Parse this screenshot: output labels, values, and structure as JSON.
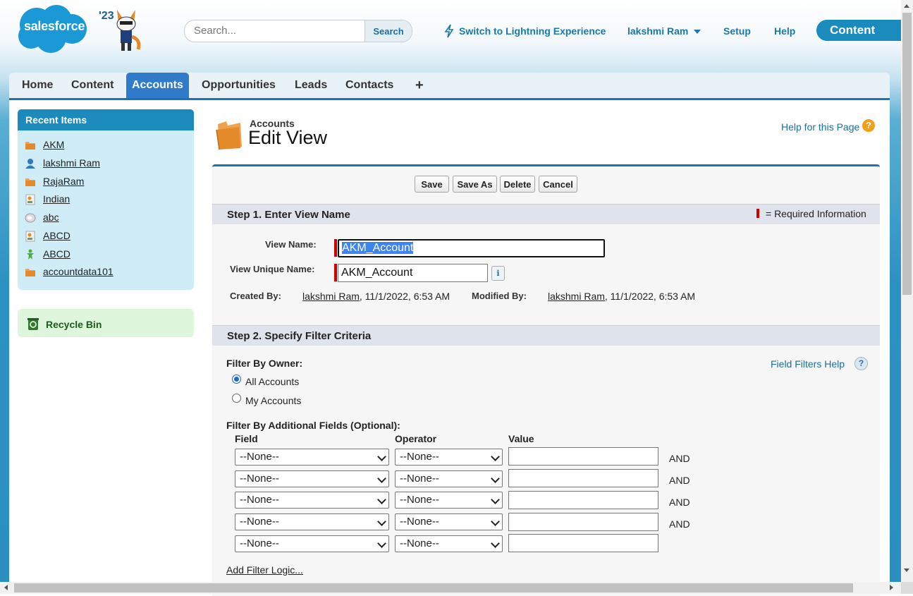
{
  "header": {
    "logo_text": "salesforce",
    "year": "'23",
    "search": {
      "placeholder": "Search...",
      "button": "Search"
    },
    "lightning_link": "Switch to Lightning Experience",
    "user_menu": "lakshmi Ram",
    "setup": "Setup",
    "help": "Help",
    "app": "Content"
  },
  "tabs": [
    {
      "label": "Home"
    },
    {
      "label": "Content"
    },
    {
      "label": "Accounts"
    },
    {
      "label": "Opportunities"
    },
    {
      "label": "Leads"
    },
    {
      "label": "Contacts"
    },
    {
      "label": "+"
    }
  ],
  "sidebar": {
    "recent_title": "Recent Items",
    "items": [
      {
        "label": "AKM",
        "icon": "account-folder-icon"
      },
      {
        "label": "lakshmi Ram",
        "icon": "user-icon"
      },
      {
        "label": "RajaRam",
        "icon": "account-folder-icon"
      },
      {
        "label": "Indian",
        "icon": "contact-card-icon"
      },
      {
        "label": "abc",
        "icon": "chat-bubble-icon"
      },
      {
        "label": "ABCD",
        "icon": "contact-card-icon"
      },
      {
        "label": "ABCD",
        "icon": "person-icon"
      },
      {
        "label": "accountdata101",
        "icon": "account-folder-icon"
      }
    ],
    "recycle_bin": "Recycle Bin"
  },
  "page": {
    "object": "Accounts",
    "title": "Edit View",
    "help_link": "Help for this Page"
  },
  "buttons": {
    "save": "Save",
    "save_as": "Save As",
    "delete": "Delete",
    "cancel": "Cancel"
  },
  "step1": {
    "title": "Step 1. Enter View Name",
    "required_info": "= Required Information",
    "view_name_label": "View Name:",
    "view_name_value": "AKM_Account",
    "unique_name_label": "View Unique Name:",
    "unique_name_value": "AKM_Account",
    "info_icon": "i",
    "created_by_label": "Created By:",
    "created_by_user": "lakshmi Ram",
    "created_by_date": ", 11/1/2022, 6:53 AM",
    "modified_by_label": "Modified By:",
    "modified_by_user": "lakshmi Ram",
    "modified_by_date": ", 11/1/2022, 6:53 AM"
  },
  "step2": {
    "title": "Step 2. Specify Filter Criteria",
    "field_filters_help": "Field Filters Help",
    "filter_by_owner": "Filter By Owner:",
    "owner_options": [
      {
        "label": "All Accounts",
        "checked": true
      },
      {
        "label": "My Accounts",
        "checked": false
      }
    ],
    "additional_fields": "Filter By Additional Fields (Optional):",
    "col_field": "Field",
    "col_operator": "Operator",
    "col_value": "Value",
    "rows": [
      {
        "field": "--None--",
        "operator": "--None--",
        "value": "",
        "conj": "AND"
      },
      {
        "field": "--None--",
        "operator": "--None--",
        "value": "",
        "conj": "AND"
      },
      {
        "field": "--None--",
        "operator": "--None--",
        "value": "",
        "conj": "AND"
      },
      {
        "field": "--None--",
        "operator": "--None--",
        "value": "",
        "conj": "AND"
      },
      {
        "field": "--None--",
        "operator": "--None--",
        "value": "",
        "conj": ""
      }
    ],
    "add_filter_logic": "Add Filter Logic..."
  },
  "colors": {
    "brand": "#1b8bbd",
    "tab_active": "#2f7bc9",
    "required": "#cc0000"
  }
}
